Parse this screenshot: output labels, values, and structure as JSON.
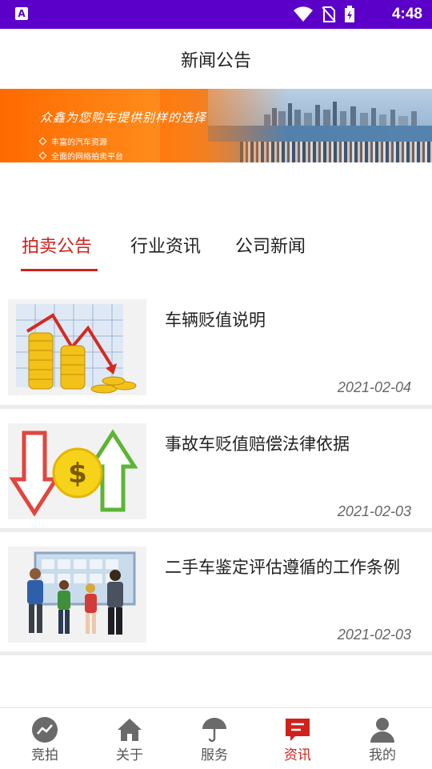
{
  "status_bar": {
    "badge": "A",
    "time": "4:48"
  },
  "header": {
    "title": "新闻公告"
  },
  "banner": {
    "headline": "众鑫为您购车提供别样的选择",
    "points": [
      "丰富的汽车资源",
      "全面的网络拍卖平台"
    ]
  },
  "tabs": [
    {
      "label": "拍卖公告",
      "active": true
    },
    {
      "label": "行业资讯",
      "active": false
    },
    {
      "label": "公司新闻",
      "active": false
    }
  ],
  "news": [
    {
      "title": "车辆贬值说明",
      "date": "2021-02-04",
      "thumb_icon": "coins-chart-icon"
    },
    {
      "title": "事故车贬值赔偿法律依据",
      "date": "2021-02-03",
      "thumb_icon": "dollar-arrows-icon"
    },
    {
      "title": "二手车鉴定评估遵循的工作条例",
      "date": "2021-02-03",
      "thumb_icon": "people-board-icon"
    }
  ],
  "bottom_nav": [
    {
      "label": "竞拍",
      "icon": "trend-icon",
      "active": false
    },
    {
      "label": "关于",
      "icon": "home-icon",
      "active": false
    },
    {
      "label": "服务",
      "icon": "umbrella-icon",
      "active": false
    },
    {
      "label": "资讯",
      "icon": "message-icon",
      "active": true
    },
    {
      "label": "我的",
      "icon": "person-icon",
      "active": false
    }
  ],
  "colors": {
    "status_bar": "#5b00c9",
    "accent": "#d0221c",
    "banner_orange": "#ff6a00"
  }
}
